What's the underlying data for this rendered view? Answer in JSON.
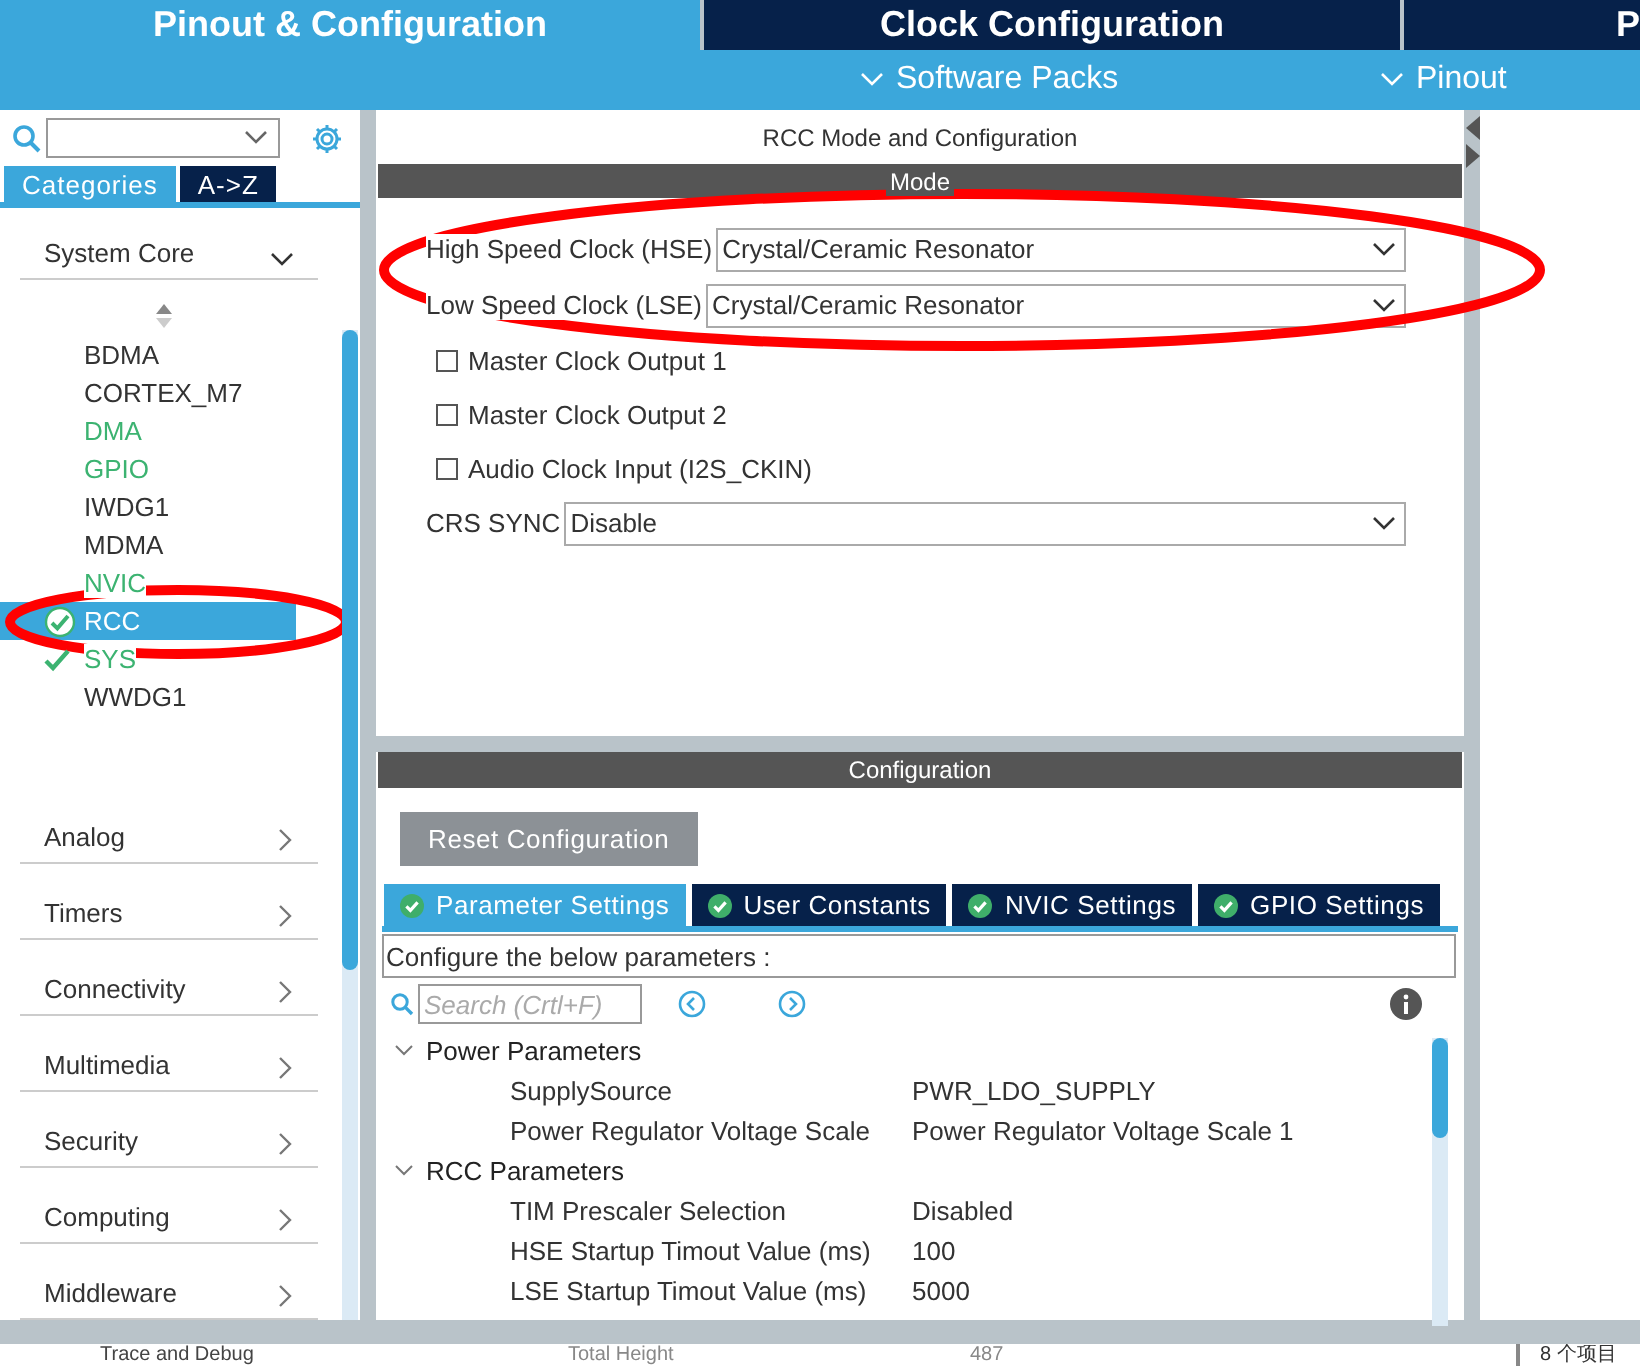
{
  "top_tabs": [
    {
      "label": "Pinout & Configuration",
      "selected": true
    },
    {
      "label": "Clock Configuration",
      "selected": false
    },
    {
      "label": "P",
      "selected": false
    }
  ],
  "sub_menu": [
    "Software Packs",
    "Pinout"
  ],
  "sidebar": {
    "tabs": [
      {
        "label": "Categories",
        "selected": true
      },
      {
        "label": "A->Z",
        "selected": false
      }
    ],
    "groups": [
      {
        "label": "System Core",
        "expanded": true,
        "children": [
          {
            "label": "BDMA",
            "configured": false,
            "checked": false,
            "selected": false,
            "circled": false
          },
          {
            "label": "CORTEX_M7",
            "configured": false,
            "checked": false,
            "selected": false,
            "circled": false
          },
          {
            "label": "DMA",
            "configured": true,
            "checked": false,
            "selected": false,
            "circled": false
          },
          {
            "label": "GPIO",
            "configured": true,
            "checked": false,
            "selected": false,
            "circled": false
          },
          {
            "label": "IWDG1",
            "configured": false,
            "checked": false,
            "selected": false,
            "circled": false
          },
          {
            "label": "MDMA",
            "configured": false,
            "checked": false,
            "selected": false,
            "circled": false
          },
          {
            "label": "NVIC",
            "configured": true,
            "checked": false,
            "selected": false,
            "circled": false
          },
          {
            "label": "RCC",
            "configured": true,
            "checked": true,
            "selected": true,
            "circled": true
          },
          {
            "label": "SYS",
            "configured": true,
            "checked": true,
            "selected": false,
            "circled": false
          },
          {
            "label": "WWDG1",
            "configured": false,
            "checked": false,
            "selected": false,
            "circled": false
          }
        ]
      },
      {
        "label": "Analog",
        "expanded": false
      },
      {
        "label": "Timers",
        "expanded": false
      },
      {
        "label": "Connectivity",
        "expanded": false
      },
      {
        "label": "Multimedia",
        "expanded": false
      },
      {
        "label": "Security",
        "expanded": false
      },
      {
        "label": "Computing",
        "expanded": false
      },
      {
        "label": "Middleware",
        "expanded": false
      }
    ]
  },
  "mode_panel": {
    "title": "RCC Mode and Configuration",
    "header": "Mode",
    "clock_sources_circled": true,
    "fields": [
      {
        "kind": "select",
        "label": "High Speed Clock (HSE)",
        "value": "Crystal/Ceramic Resonator"
      },
      {
        "kind": "select",
        "label": "Low Speed Clock (LSE)",
        "value": "Crystal/Ceramic Resonator"
      },
      {
        "kind": "checkbox",
        "label": "Master Clock Output 1",
        "checked": false
      },
      {
        "kind": "checkbox",
        "label": "Master Clock Output 2",
        "checked": false
      },
      {
        "kind": "checkbox",
        "label": "Audio Clock Input (I2S_CKIN)",
        "checked": false
      },
      {
        "kind": "select",
        "label": "CRS SYNC",
        "value": "Disable"
      }
    ]
  },
  "config_panel": {
    "header": "Configuration",
    "reset_button": "Reset Configuration",
    "tabs": [
      {
        "label": "Parameter Settings",
        "selected": true
      },
      {
        "label": "User Constants",
        "selected": false
      },
      {
        "label": "NVIC Settings",
        "selected": false
      },
      {
        "label": "GPIO Settings",
        "selected": false
      }
    ],
    "description": "Configure the below parameters :",
    "search_placeholder": "Search (Crtl+F)",
    "groups": [
      {
        "label": "Power Parameters",
        "expanded": true,
        "children": [
          {
            "name": "SupplySource",
            "value": "PWR_LDO_SUPPLY"
          },
          {
            "name": "Power Regulator Voltage Scale",
            "value": "Power Regulator Voltage Scale 1"
          }
        ]
      },
      {
        "label": "RCC Parameters",
        "expanded": true,
        "children": [
          {
            "name": "TIM Prescaler Selection",
            "value": "Disabled"
          },
          {
            "name": "HSE Startup Timout Value (ms)",
            "value": "100"
          },
          {
            "name": "LSE Startup Timout Value (ms)",
            "value": "5000"
          }
        ]
      }
    ]
  },
  "bottom_strip": {
    "left": "Trace and Debug",
    "center_label": "Total Height",
    "center_value": "487",
    "right": "8 个项目"
  }
}
